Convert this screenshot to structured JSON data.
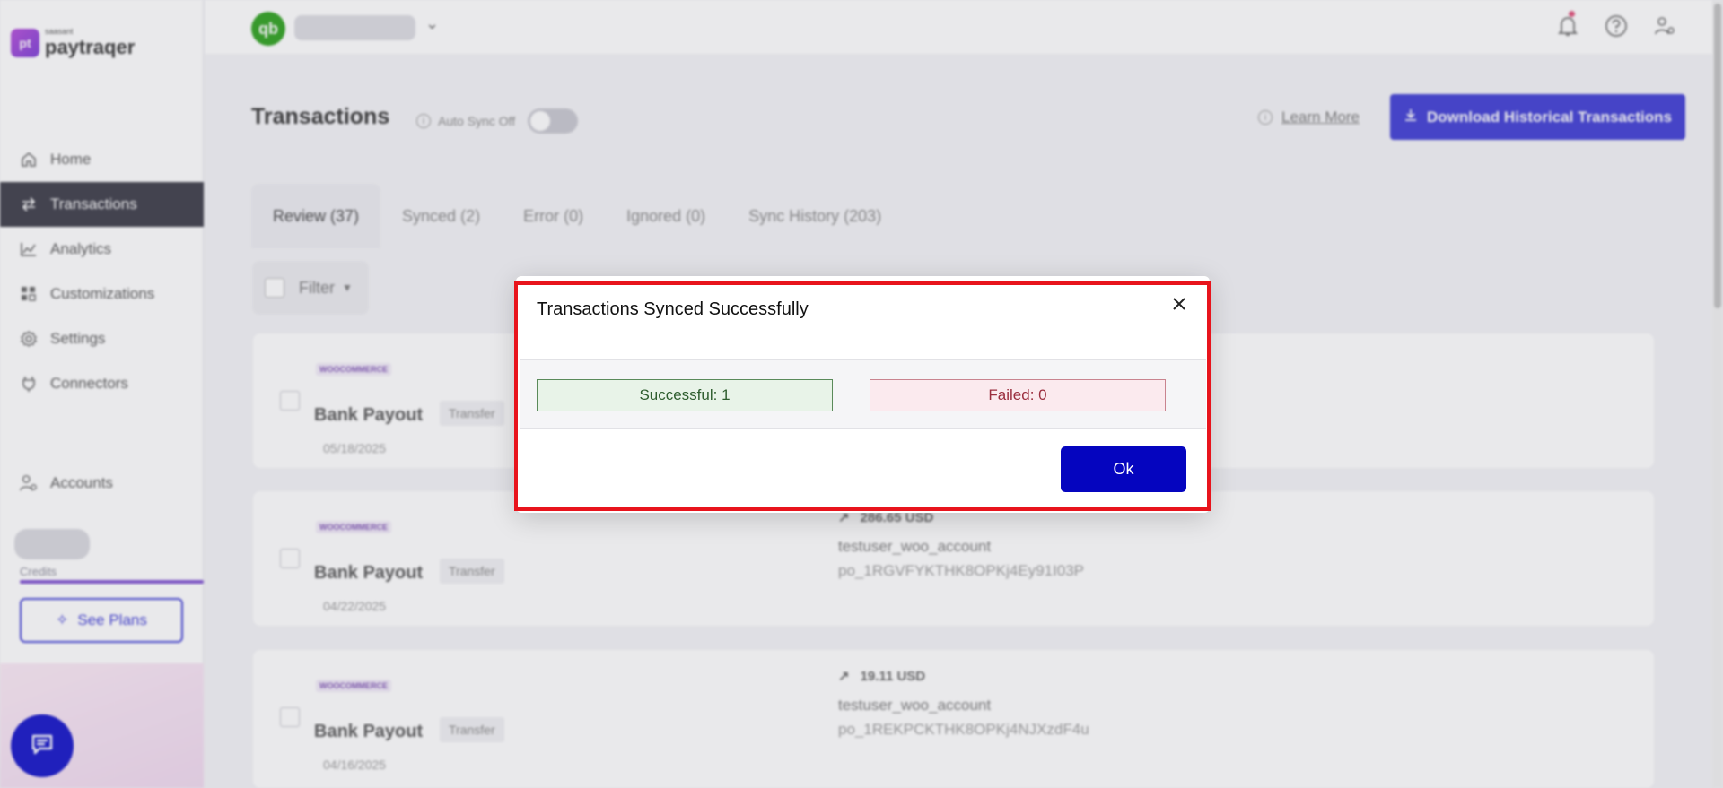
{
  "app": {
    "logo_mark": "pt",
    "logo_small": "saasant",
    "logo_name": "paytraqer"
  },
  "sidebar": {
    "items": [
      {
        "label": "Home",
        "icon": "home-icon"
      },
      {
        "label": "Transactions",
        "icon": "transfer-icon"
      },
      {
        "label": "Analytics",
        "icon": "chart-icon"
      },
      {
        "label": "Customizations",
        "icon": "grid-icon"
      },
      {
        "label": "Settings",
        "icon": "gear-icon"
      },
      {
        "label": "Connectors",
        "icon": "plug-icon"
      }
    ],
    "accounts_label": "Accounts",
    "credits_label": "Credits",
    "see_plans_label": "See Plans"
  },
  "header": {
    "company_logo_text": "qb"
  },
  "page": {
    "title": "Transactions",
    "auto_sync_label": "Auto Sync Off",
    "learn_more_label": "Learn More",
    "download_label": "Download Historical Transactions"
  },
  "tabs": [
    {
      "label": "Review (37)"
    },
    {
      "label": "Synced (2)"
    },
    {
      "label": "Error (0)"
    },
    {
      "label": "Ignored (0)"
    },
    {
      "label": "Sync History (203)"
    }
  ],
  "filter": {
    "label": "Filter"
  },
  "transactions": [
    {
      "source": "WOOCOMMERCE",
      "title": "Bank Payout",
      "tag": "Transfer",
      "date": "05/18/2025",
      "amount": "",
      "account": "",
      "payout_id": ""
    },
    {
      "source": "WOOCOMMERCE",
      "title": "Bank Payout",
      "tag": "Transfer",
      "date": "04/22/2025",
      "amount": "286.65 USD",
      "account": "testuser_woo_account",
      "payout_id": "po_1RGVFYKTHK8OPKj4Ey91I03P"
    },
    {
      "source": "WOOCOMMERCE",
      "title": "Bank Payout",
      "tag": "Transfer",
      "date": "04/16/2025",
      "amount": "19.11 USD",
      "account": "testuser_woo_account",
      "payout_id": "po_1REKPCKTHK8OPKj4NJXzdF4u"
    }
  ],
  "modal": {
    "title": "Transactions Synced Successfully",
    "successful_text": "Successful: 1",
    "failed_text": "Failed: 0",
    "ok_label": "Ok",
    "colors": {
      "success_bg": "#e8f3e8",
      "failed_bg": "#fbeaee",
      "ok_button": "#0505bf",
      "highlight_border": "#e8141c"
    }
  }
}
